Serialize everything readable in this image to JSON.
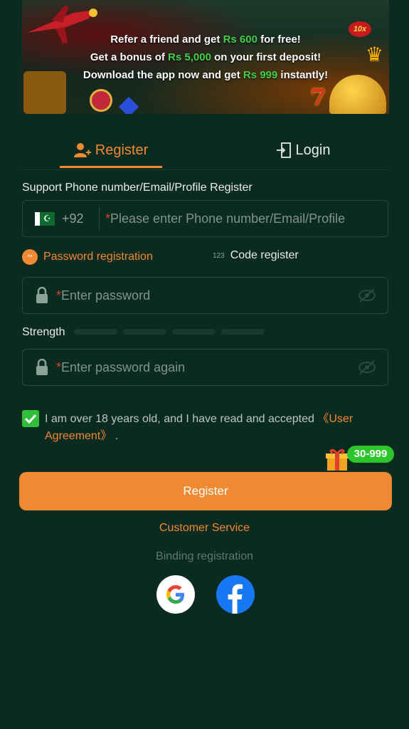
{
  "banner": {
    "line1_pre": "Refer a friend and get",
    "line1_amount": "Rs 600",
    "line1_post": "for free!",
    "line2_pre": "Get a bonus of",
    "line2_amount": "Rs 5,000",
    "line2_post": "on your first deposit!",
    "line3_pre": "Download the app now and get",
    "line3_amount": "Rs 999",
    "line3_post": "instantly!",
    "badge": "10x"
  },
  "tabs": [
    {
      "label": "Register",
      "active": true,
      "icon": "user-add-icon"
    },
    {
      "label": "Login",
      "active": false,
      "icon": "door-enter-icon"
    }
  ],
  "form": {
    "account_label": "Support Phone number/Email/Profile Register",
    "country_code": "+92",
    "country_flag": "pakistan-flag-icon",
    "account_placeholder_star": "*",
    "account_placeholder": "Please enter Phone number/Email/Profile",
    "mode_password": "Password registration",
    "mode_password_icon_text": "**",
    "mode_code_icon_text": "123",
    "mode_code": "Code register",
    "password_placeholder_star": "*",
    "password_placeholder": "Enter password",
    "strength_label": "Strength",
    "strength_level": 0,
    "confirm_placeholder_star": "*",
    "confirm_placeholder": "Enter password again",
    "agree_checked": true,
    "agree_text": "I am over 18 years old, and I have read and accepted ",
    "agree_link": "《User Agreement》",
    "agree_end": " ."
  },
  "promo_badge": "30-999",
  "register_button": "Register",
  "customer_service": "Customer Service",
  "binding_label": "Binding registration",
  "social": [
    "google-icon",
    "facebook-icon"
  ],
  "colors": {
    "background": "#0b2a20",
    "accent": "#f08a32",
    "green": "#2fbf3a"
  }
}
